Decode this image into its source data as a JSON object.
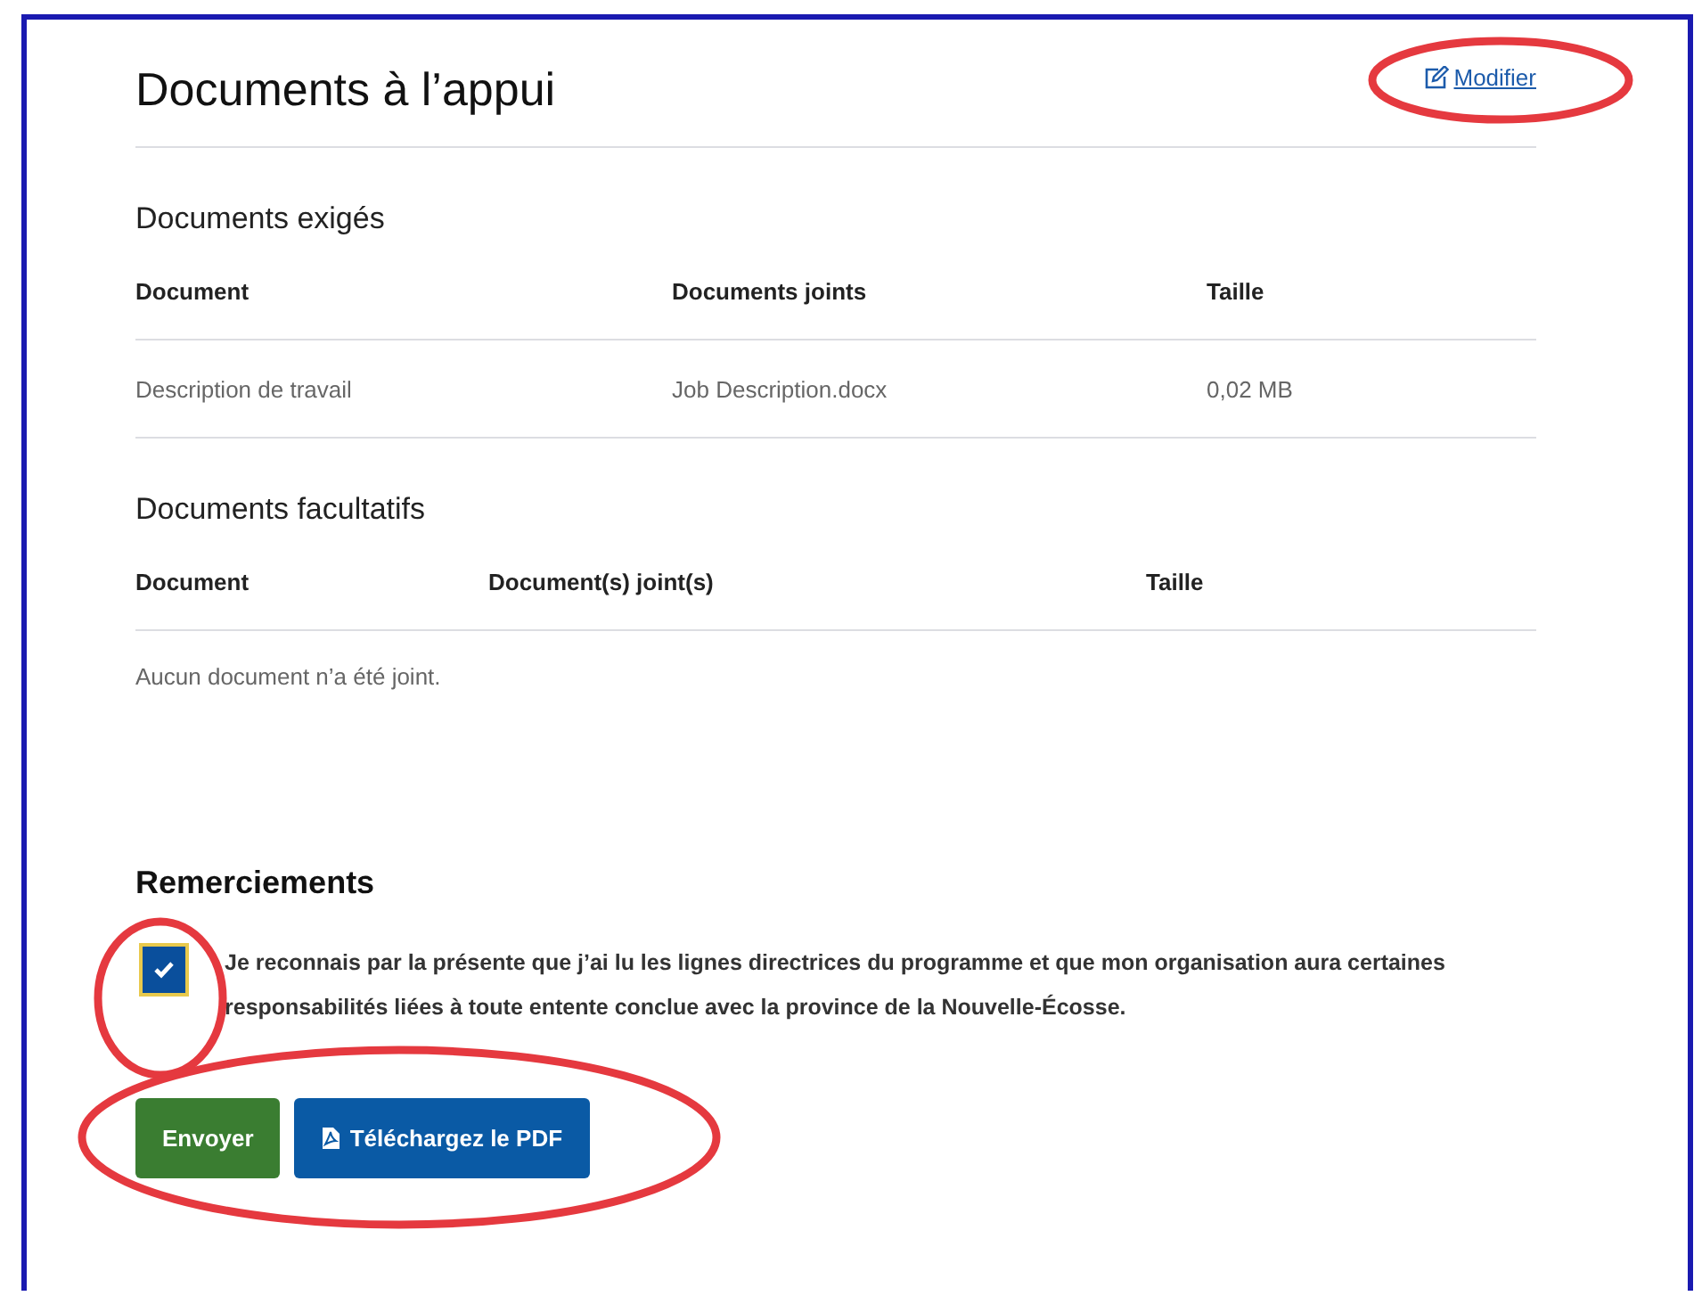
{
  "header": {
    "title": "Documents à l’appui",
    "edit_link": {
      "label": "Modifier",
      "highlighted": true
    }
  },
  "sections": [
    {
      "title": "Documents exigés",
      "columns": [
        "Document",
        "Documents joints",
        "Taille"
      ],
      "rows": [
        [
          "Description de travail",
          "Job Description.docx",
          "0,02 MB"
        ]
      ]
    },
    {
      "title": "Documents facultatifs",
      "columns": [
        "Document",
        "Document(s) joint(s)",
        "Taille"
      ],
      "empty_message": "Aucun document n’a été joint."
    }
  ],
  "acknowledgement": {
    "title": "Remerciements",
    "checked": true,
    "highlighted": true,
    "text": "Je reconnais par la présente que j’ai lu les lignes directrices du programme et que mon organisation aura certaines responsabilités liées à toute entente conclue avec la province de la Nouvelle-Écosse."
  },
  "actions": {
    "highlighted": true,
    "buttons": [
      {
        "kind": "submit",
        "label": "Envoyer"
      },
      {
        "kind": "pdf",
        "label": "Téléchargez le PDF"
      }
    ]
  }
}
